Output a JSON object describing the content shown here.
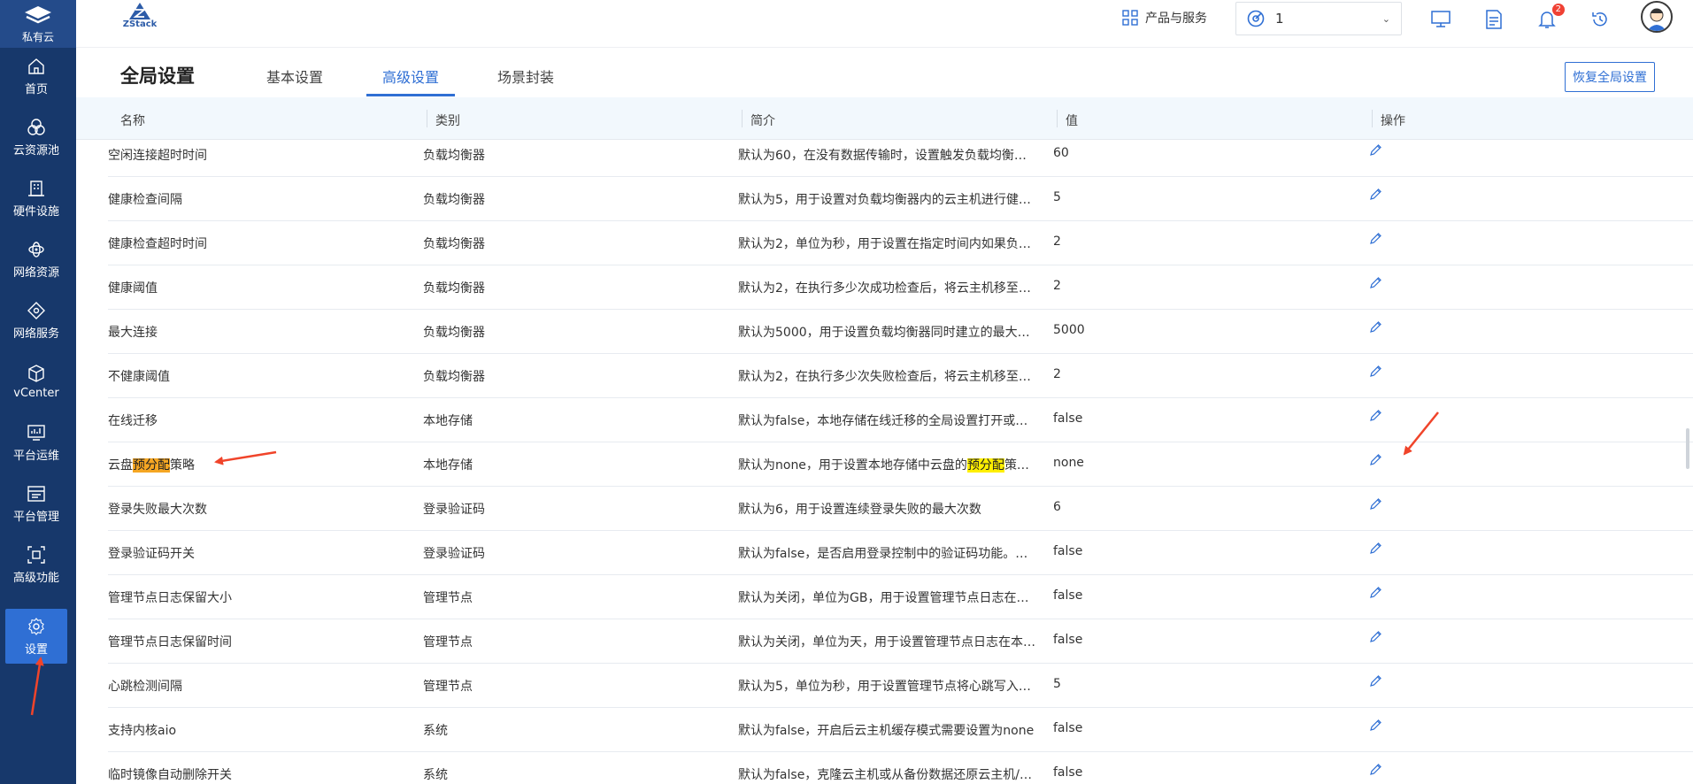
{
  "sidebar": {
    "brand": "私有云",
    "items": [
      {
        "label": "首页",
        "icon": "home-icon"
      },
      {
        "label": "云资源池",
        "icon": "resource-pool-icon"
      },
      {
        "label": "硬件设施",
        "icon": "hardware-icon"
      },
      {
        "label": "网络资源",
        "icon": "network-resource-icon"
      },
      {
        "label": "网络服务",
        "icon": "network-service-icon"
      },
      {
        "label": "vCenter",
        "icon": "vcenter-cube-icon"
      },
      {
        "label": "平台运维",
        "icon": "monitor-icon"
      },
      {
        "label": "平台管理",
        "icon": "management-icon"
      },
      {
        "label": "高级功能",
        "icon": "advanced-icon"
      },
      {
        "label": "设置",
        "icon": "gear-icon",
        "active": true
      }
    ]
  },
  "header": {
    "logo_text": "ZStack",
    "products": "产品与服务",
    "project_value": "1",
    "notification_count": "2"
  },
  "titlebar": {
    "title": "全局设置",
    "tabs": [
      "基本设置",
      "高级设置",
      "场景封装"
    ],
    "active_tab": "高级设置",
    "restore_button": "恢复全局设置"
  },
  "table": {
    "columns": [
      "名称",
      "类别",
      "简介",
      "值",
      "操作"
    ],
    "rows": [
      {
        "name": "空闲连接超时时间",
        "category": "负载均衡器",
        "desc": "默认为60，在没有数据传输时，设置触发负载均衡…",
        "value": "60"
      },
      {
        "name": "健康检查间隔",
        "category": "负载均衡器",
        "desc": "默认为5，用于设置对负载均衡器内的云主机进行健…",
        "value": "5"
      },
      {
        "name": "健康检查超时时间",
        "category": "负载均衡器",
        "desc": "默认为2，单位为秒，用于设置在指定时间内如果负…",
        "value": "2"
      },
      {
        "name": "健康阈值",
        "category": "负载均衡器",
        "desc": "默认为2，在执行多少次成功检查后，将云主机移至…",
        "value": "2"
      },
      {
        "name": "最大连接",
        "category": "负载均衡器",
        "desc": "默认为5000，用于设置负载均衡器同时建立的最大…",
        "value": "5000"
      },
      {
        "name": "不健康阈值",
        "category": "负载均衡器",
        "desc": "默认为2，在执行多少次失败检查后，将云主机移至…",
        "value": "2"
      },
      {
        "name": "在线迁移",
        "category": "本地存储",
        "desc": "默认为false，本地存储在线迁移的全局设置打开或…",
        "value": "false"
      },
      {
        "name": "云盘预分配策略",
        "name_parts": [
          "云盘",
          "预分配",
          "策略"
        ],
        "category": "本地存储",
        "desc": "默认为none，用于设置本地存储中云盘的预分配策…",
        "desc_parts": [
          "默认为none，用于设置本地存储中云盘的",
          "预分配",
          "策…"
        ],
        "value": "none"
      },
      {
        "name": "登录失败最大次数",
        "category": "登录验证码",
        "desc": "默认为6，用于设置连续登录失败的最大次数",
        "value": "6"
      },
      {
        "name": "登录验证码开关",
        "category": "登录验证码",
        "desc": "默认为false，是否启用登录控制中的验证码功能。…",
        "value": "false"
      },
      {
        "name": "管理节点日志保留大小",
        "category": "管理节点",
        "desc": "默认为关闭，单位为GB，用于设置管理节点日志在…",
        "value": "false"
      },
      {
        "name": "管理节点日志保留时间",
        "category": "管理节点",
        "desc": "默认为关闭，单位为天，用于设置管理节点日志在本…",
        "value": "false"
      },
      {
        "name": "心跳检测间隔",
        "category": "管理节点",
        "desc": "默认为5，单位为秒，用于设置管理节点将心跳写入…",
        "value": "5"
      },
      {
        "name": "支持内核aio",
        "category": "系统",
        "desc": "默认为false，开启后云主机缓存模式需要设置为none",
        "value": "false"
      },
      {
        "name": "临时镜像自动删除开关",
        "category": "系统",
        "desc": "默认为false，克隆云主机或从备份数据还原云主机/…",
        "value": "false"
      }
    ]
  },
  "colors": {
    "sidebar_bg": "#17386b",
    "accent": "#2f6fd4",
    "highlight_orange": "#f5a623",
    "highlight_yellow": "#ffef00",
    "annotation_arrow": "#f0442a"
  }
}
